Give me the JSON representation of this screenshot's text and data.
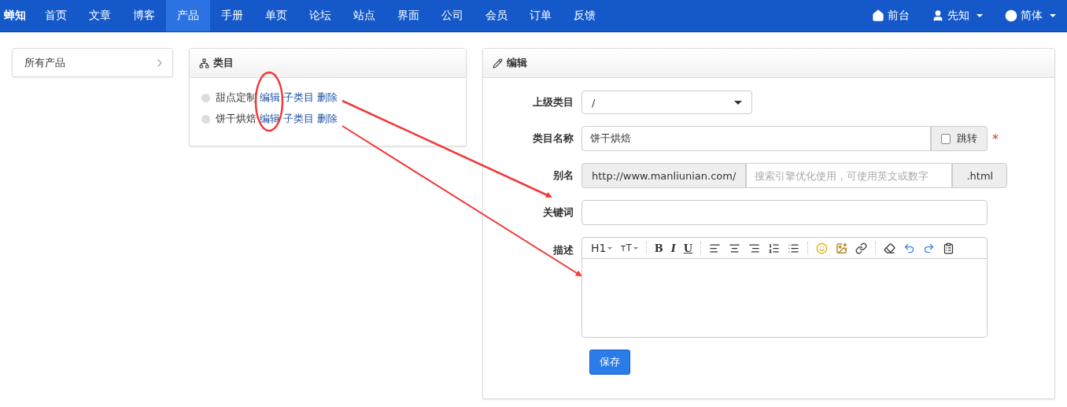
{
  "nav": {
    "brand": "蝉知",
    "items": [
      {
        "label": "首页",
        "selected": false
      },
      {
        "label": "文章",
        "selected": false
      },
      {
        "label": "博客",
        "selected": false
      },
      {
        "label": "产品",
        "selected": true
      },
      {
        "label": "手册",
        "selected": false
      },
      {
        "label": "单页",
        "selected": false
      },
      {
        "label": "论坛",
        "selected": false
      },
      {
        "label": "站点",
        "selected": false
      },
      {
        "label": "界面",
        "selected": false
      },
      {
        "label": "公司",
        "selected": false
      },
      {
        "label": "会员",
        "selected": false
      },
      {
        "label": "订单",
        "selected": false
      },
      {
        "label": "反馈",
        "selected": false
      }
    ],
    "right": [
      {
        "label": "前台",
        "caret": false
      },
      {
        "label": "先知",
        "caret": true
      },
      {
        "label": "简体",
        "caret": true
      }
    ]
  },
  "sidebar": {
    "items": [
      {
        "label": "所有产品"
      }
    ]
  },
  "category_panel": {
    "title": "类目",
    "items": [
      {
        "name": "甜点定制",
        "actions": [
          "编辑",
          "子类目",
          "删除"
        ]
      },
      {
        "name": "饼干烘焙",
        "actions": [
          "编辑",
          "子类目",
          "删除"
        ]
      }
    ]
  },
  "edit_panel": {
    "title": "编辑",
    "fields": [
      {
        "kind": "select",
        "label": "上级类目",
        "value": "/"
      },
      {
        "kind": "name",
        "label": "类目名称",
        "value": "饼干烘焙",
        "checkbox": {
          "label": "跳转",
          "checked": false
        },
        "required_mark": "*"
      },
      {
        "kind": "alias",
        "label": "别名",
        "prefix": "http://www.manliunian.com/",
        "placeholder": "搜索引擎优化使用，可使用英文或数字",
        "suffix": ".html"
      },
      {
        "kind": "text",
        "label": "关键词"
      },
      {
        "kind": "editor",
        "label": "描述",
        "toolbar": {
          "headings": [
            "H1",
            "ᴛT"
          ],
          "styles": [
            "B",
            "I",
            "U"
          ]
        }
      }
    ],
    "save": "保存"
  }
}
